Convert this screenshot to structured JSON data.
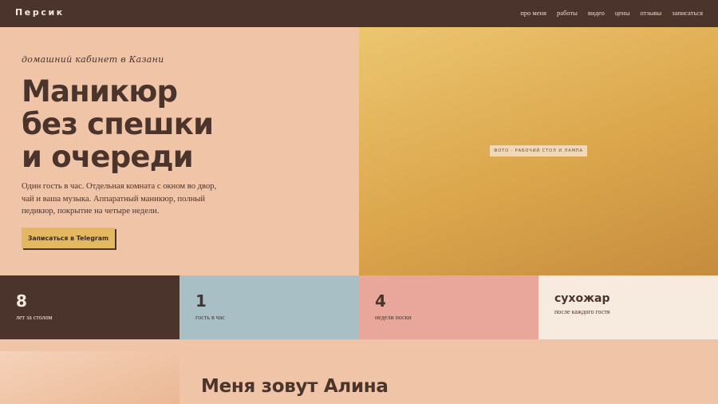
{
  "nav": {
    "logo": "Персик",
    "links": [
      "про меня",
      "работы",
      "видео",
      "цены",
      "отзывы",
      "записаться"
    ]
  },
  "hero": {
    "kicker": "домашний кабинет в Казани",
    "headline": [
      "Маникюр",
      "без спешки",
      "и очереди"
    ],
    "description": "Один гость в час. Отдельная комната с окном во двор, чай и ваша музыка. Аппаратный маникюр, полный педикюр, покрытие на четыре недели.",
    "cta_label": "Записаться в Telegram",
    "photo_label": "ФОТО · РАБОЧИЙ СТОЛ И ЛАМПА"
  },
  "stats": [
    {
      "value": "8",
      "caption": "лет за столом"
    },
    {
      "value": "1",
      "caption": "гость в час"
    },
    {
      "value": "4",
      "caption": "недели носки"
    },
    {
      "value": "сухожар",
      "caption": "после каждого гостя"
    }
  ],
  "about": {
    "title": "Меня зовут Алина"
  },
  "colors": {
    "brown": "#4a342c",
    "peach": "#f0c4a7",
    "mustard": "#e4b861",
    "blue_grey": "#a8bfc6",
    "rose": "#e8a79a",
    "cream": "#f7eade"
  }
}
